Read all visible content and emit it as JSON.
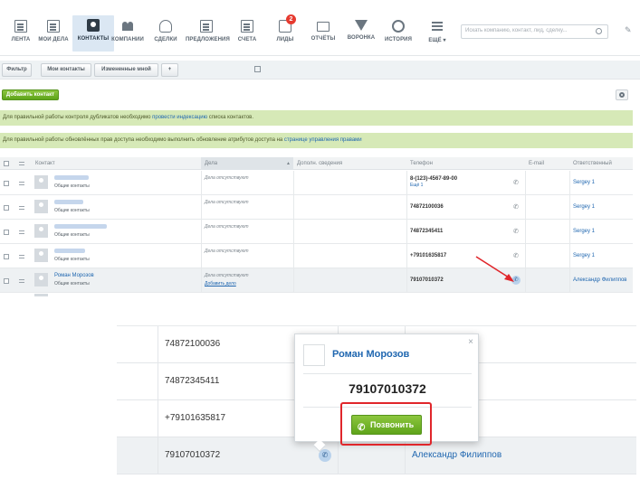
{
  "nav": {
    "items": [
      {
        "label": "ЛЕНТА"
      },
      {
        "label": "МОИ ДЕЛА"
      },
      {
        "label": "КОНТАКТЫ"
      },
      {
        "label": "КОМПАНИИ"
      },
      {
        "label": "СДЕЛКИ"
      },
      {
        "label": "ПРЕДЛОЖЕНИЯ"
      },
      {
        "label": "СЧЕТА"
      },
      {
        "label": "ЛИДЫ",
        "badge": "2"
      },
      {
        "label": "ОТЧЁТЫ"
      },
      {
        "label": "ВОРОНКА"
      },
      {
        "label": "ИСТОРИЯ"
      },
      {
        "label": "ЕЩЁ ▾"
      }
    ],
    "active_index": 2,
    "search_placeholder": "Искать компанию, контакт, лид, сделку...",
    "pin_icon": "pin-icon"
  },
  "filters": {
    "filter_label": "Фильтр",
    "my_contacts_label": "Мои контакты",
    "changed_by_me_label": "Измененные мной",
    "add_label": "+"
  },
  "actions": {
    "add_contact_label": "Добавить контакт",
    "settings_icon": "gear-icon"
  },
  "notices": {
    "dup_text": "Для правильной работы контроля дубликатов необходимо ",
    "dup_link": "провести индексацию",
    "dup_text_end": " списка контактов.",
    "rights_text": "Для правильной работы обновлённых прав доступа необходимо выполнить обновление атрибутов доступа на ",
    "rights_link": "странице управления правами"
  },
  "table": {
    "headers": {
      "contact": "Контакт",
      "deals": "Дела",
      "extra": "Дополн. сведения",
      "phone": "Телефон",
      "email": "E-mail",
      "responsible": "Ответственный"
    },
    "rows": [
      {
        "name": "",
        "type": "Общие контакты",
        "deals": "Дела отсутствуют",
        "deals_add": "",
        "phone": "8-(123)-4567-89-00",
        "phone_ext": "Ещё 1",
        "responsible": "Sergey 1"
      },
      {
        "name": "",
        "type": "Общие контакты",
        "deals": "Дела отсутствуют",
        "deals_add": "",
        "phone": "74872100036",
        "phone_ext": "",
        "responsible": "Sergey 1"
      },
      {
        "name": "",
        "type": "Общие контакты",
        "deals": "Дела отсутствуют",
        "deals_add": "",
        "phone": "74872345411",
        "phone_ext": "",
        "responsible": "Sergey 1"
      },
      {
        "name": "",
        "type": "Общие контакты",
        "deals": "Дела отсутствуют",
        "deals_add": "",
        "phone": "+79101635817",
        "phone_ext": "",
        "responsible": "Sergey 1"
      },
      {
        "name": "Роман Морозов",
        "type": "Общие контакты",
        "deals": "Дела отсутствуют",
        "deals_add": "Добавить дело",
        "phone": "79107010372",
        "phone_ext": "",
        "responsible": "Александр Филиппов"
      }
    ]
  },
  "zoom": {
    "rows": [
      {
        "phone": "74872100036",
        "responsible": ""
      },
      {
        "phone": "74872345411",
        "responsible": ""
      },
      {
        "phone": "+79101635817",
        "responsible": ""
      },
      {
        "phone": "79107010372",
        "responsible": "Александр Филиппов"
      }
    ],
    "popup": {
      "name": "Роман Морозов",
      "phone": "79107010372",
      "call_label": "Позвонить",
      "close": "×"
    }
  },
  "colors": {
    "accent_green": "#6db32a",
    "link_blue": "#2067b0",
    "notice_bg": "#d6e9b7",
    "highlight_red": "#e0262b"
  }
}
